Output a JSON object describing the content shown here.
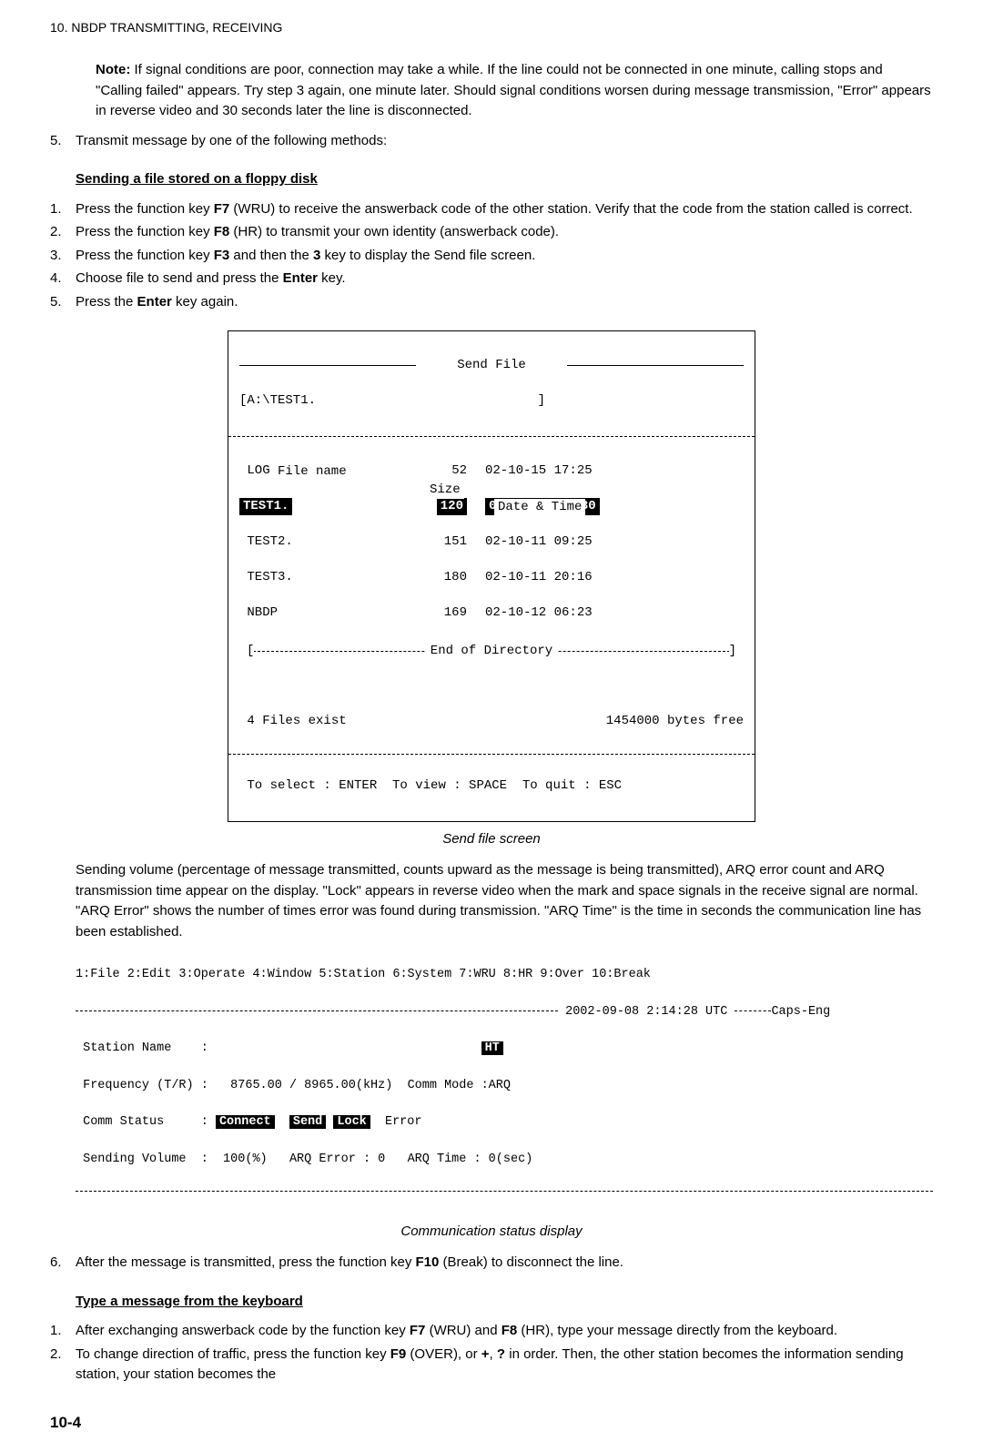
{
  "header": "10. NBDP TRANSMITTING, RECEIVING",
  "note": {
    "label": "Note:",
    "text": "If signal conditions are poor, connection may take a while. If the line could not be connected in one minute, calling stops and \"Calling failed\" appears. Try step 3 again, one minute later. Should signal conditions worsen during message transmission, \"Error\" appears in reverse video and 30 seconds later the line is disconnected."
  },
  "step5_top": "Transmit message by one of the following methods:",
  "headings": {
    "floppy": "Sending a file stored on a floppy disk",
    "keyboard": "Type a message from the keyboard"
  },
  "floppy_steps": {
    "s1a": "Press the function key ",
    "s1b": "F7",
    "s1c": " (WRU) to receive the answerback code of the other station. Verify that the code from the station called is correct.",
    "s2a": "Press the function key ",
    "s2b": "F8",
    "s2c": " (HR) to transmit your own identity (answerback code).",
    "s3a": "Press the function key ",
    "s3b": "F3",
    "s3c": " and then the ",
    "s3d": "3",
    "s3e": " key to display the Send file screen.",
    "s4a": "Choose file to send and press the ",
    "s4b": "Enter",
    "s4c": " key.",
    "s5a": "Press the ",
    "s5b": "Enter",
    "s5c": " key again."
  },
  "sendfile": {
    "title": "Send File",
    "path": "[A:\\TEST1.                             ]",
    "cols": {
      "name": "File name",
      "size": "Size",
      "date": "Date & Time"
    },
    "rows": [
      {
        "name": "LOG File",
        "size": "52",
        "date": "02-10-15 17:25",
        "hl": false
      },
      {
        "name": "TEST1.",
        "size": "120",
        "date": "02-10-10 16:30",
        "hl": true
      },
      {
        "name": "TEST2.",
        "size": "151",
        "date": "02-10-11 09:25",
        "hl": false
      },
      {
        "name": "TEST3.",
        "size": "180",
        "date": "02-10-11 20:16",
        "hl": false
      },
      {
        "name": "NBDP",
        "size": "169",
        "date": "02-10-12 06:23",
        "hl": false
      }
    ],
    "end": "End of Directory",
    "files_exist": "4 Files exist",
    "bytes_free": "1454000 bytes free",
    "hint": "To select : ENTER  To view : SPACE  To quit : ESC"
  },
  "caption1": "Send file screen",
  "para_sending": "Sending volume (percentage of message transmitted, counts upward as the message is being transmitted), ARQ error count and ARQ transmission time appear on the display. \"Lock\" appears in reverse video when the mark and space signals in the receive signal are normal. \"ARQ Error\" shows the number of times error was found during transmission. \"ARQ Time\" is the time in seconds the communication line has been established.",
  "comm": {
    "menu": "1:File 2:Edit 3:Operate 4:Window 5:Station 6:System 7:WRU 8:HR 9:Over 10:Break",
    "timestamp": "2002-09-08 2:14:28 UTC",
    "caps": "Caps-Eng",
    "station_label": "Station Name    :",
    "ht": "HT",
    "freq": "Frequency (T/R) :   8765.00 / 8965.00(kHz)  Comm Mode :ARQ",
    "status_label": "Comm Status     : ",
    "connect": "Connect",
    "send": "Send",
    "lock": "Lock",
    "error": "Error",
    "volume": "Sending Volume  :  100(%)   ARQ Error : 0   ARQ Time : 0(sec)"
  },
  "caption2": "Communication status display",
  "step6a": "After the message is transmitted, press the function key ",
  "step6b": "F10",
  "step6c": " (Break) to disconnect the line.",
  "kb_steps": {
    "s1a": "After exchanging answerback code by the function key ",
    "s1b": "F7",
    "s1c": " (WRU) and ",
    "s1d": "F8",
    "s1e": " (HR), type your message directly from the keyboard.",
    "s2a": "To change direction of traffic, press the function key ",
    "s2b": "F9",
    "s2c": " (OVER), or ",
    "s2d": "+",
    "s2e": ", ",
    "s2f": "?",
    "s2g": " in order. Then, the other station becomes the information sending station, your station becomes the"
  },
  "page": "10-4"
}
